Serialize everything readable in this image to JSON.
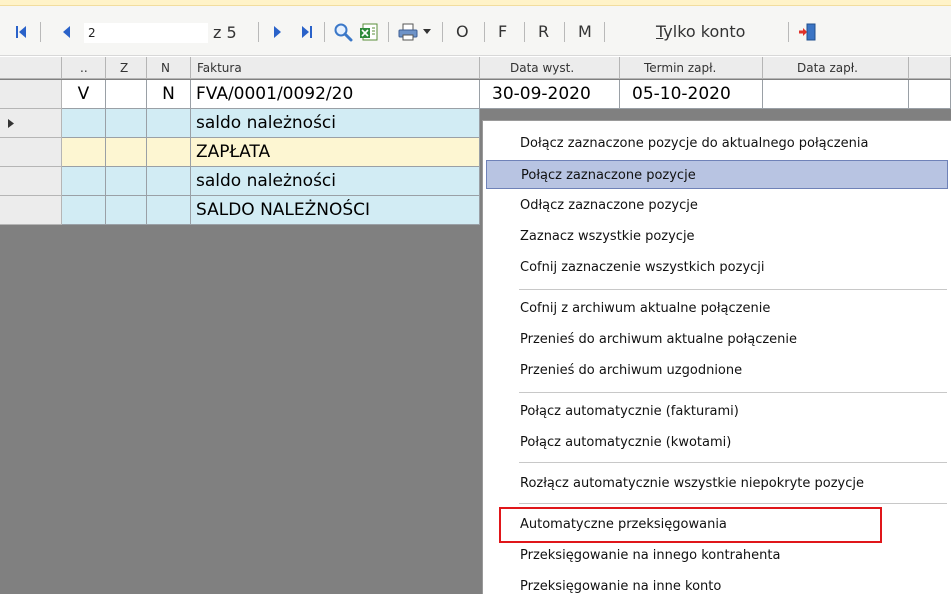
{
  "toolbar": {
    "page_value": "2",
    "page_of": "z 5",
    "btn_o": "O",
    "btn_f": "F",
    "btn_r": "R",
    "btn_m": "M",
    "tylko_first": "T",
    "tylko_rest": "ylko konto",
    "icons": [
      "first-page-icon",
      "prev-page-icon",
      "next-page-icon",
      "last-page-icon",
      "search-icon",
      "excel-export-icon",
      "print-icon",
      "dropdown-arrow-icon",
      "exit-door-icon"
    ]
  },
  "grid": {
    "headers": [
      "..",
      "Z",
      "N",
      "Faktura",
      "Data wyst.",
      "Termin zapł.",
      "Data zapł."
    ],
    "rows": [
      {
        "dots": "V",
        "z": "",
        "n": "N",
        "faktura": "FVA/0001/0092/20",
        "data_wyst": "30-09-2020",
        "termin": "05-10-2020",
        "data_zapl": "",
        "color": "#ffffff"
      },
      {
        "dots": "",
        "z": "",
        "n": "",
        "faktura": "saldo należności",
        "data_wyst": "",
        "termin": "",
        "data_zapl": "",
        "color": "#d2ecf4"
      },
      {
        "dots": "",
        "z": "",
        "n": "",
        "faktura": "ZAPŁATA",
        "data_wyst": "",
        "termin": "",
        "data_zapl": "",
        "color": "#fdf6d2"
      },
      {
        "dots": "",
        "z": "",
        "n": "",
        "faktura": "saldo należności",
        "data_wyst": "",
        "termin": "",
        "data_zapl": "",
        "color": "#d2ecf4"
      },
      {
        "dots": "",
        "z": "",
        "n": "",
        "faktura": "SALDO NALEŻNOŚCI",
        "data_wyst": "",
        "termin": "",
        "data_zapl": "",
        "color": "#d2ecf4"
      }
    ]
  },
  "menu": {
    "items": [
      "Dołącz zaznaczone pozycje do aktualnego połączenia",
      "Połącz zaznaczone pozycje",
      "Odłącz zaznaczone pozycje",
      "Zaznacz wszystkie pozycje",
      "Cofnij zaznaczenie wszystkich pozycji",
      "Cofnij z archiwum aktualne połączenie",
      "Przenieś do archiwum aktualne połączenie",
      "Przenieś do archiwum uzgodnione",
      "Połącz automatycznie (fakturami)",
      "Połącz automatycznie (kwotami)",
      "Rozłącz automatycznie wszystkie niepokryte pozycje",
      "Automatyczne przeksięgowania",
      "Przeksięgowanie na innego kontrahenta",
      "Przeksięgowanie na inne konto"
    ],
    "highlighted_index": 1,
    "annotated_index": 12,
    "highlight_color": "#b8c4e2",
    "annotation_color": "#e0161a"
  }
}
